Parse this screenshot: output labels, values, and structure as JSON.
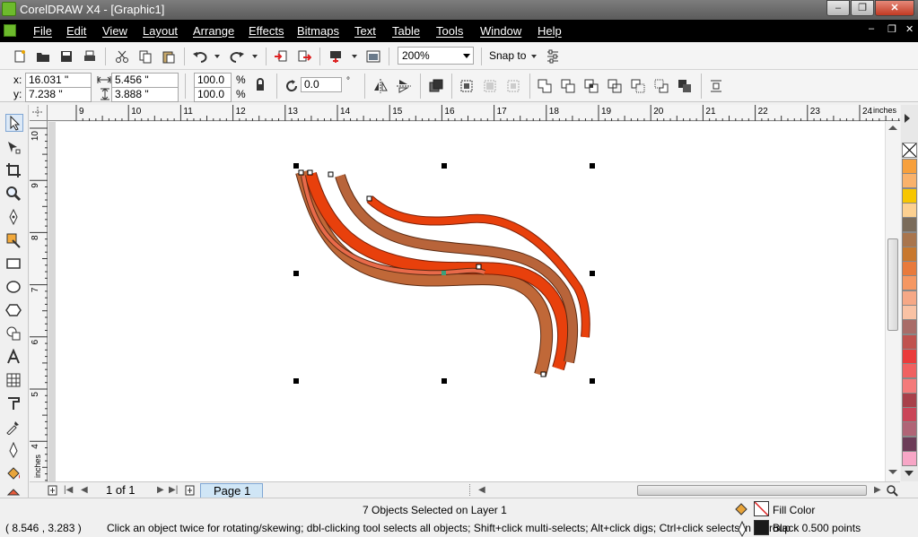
{
  "window": {
    "title": "CorelDRAW X4 - [Graphic1]",
    "min": "–",
    "max": "❐",
    "close": "✕"
  },
  "menu": [
    "File",
    "Edit",
    "View",
    "Layout",
    "Arrange",
    "Effects",
    "Bitmaps",
    "Text",
    "Table",
    "Tools",
    "Window",
    "Help"
  ],
  "doc_controls": {
    "min": "–",
    "restore": "❐",
    "close": "✕"
  },
  "toolbar": {
    "zoom": "200%",
    "snap_to": "Snap to"
  },
  "propbar": {
    "x_label": "x:",
    "x": "16.031 \"",
    "y_label": "y:",
    "y": "7.238 \"",
    "width": "5.456 \"",
    "height": "3.888 \"",
    "scale_x": "100.0",
    "scale_y": "100.0",
    "pct1": "%",
    "pct2": "%",
    "angle": "0.0",
    "deg": "°"
  },
  "ruler_h": {
    "unit": "inches",
    "ticks": [
      "9",
      "10",
      "11",
      "12",
      "13",
      "14",
      "15",
      "16",
      "17",
      "18",
      "19",
      "20",
      "21",
      "22",
      "23",
      "24"
    ]
  },
  "ruler_v": {
    "unit": "inches",
    "ticks": [
      "10",
      "9",
      "8",
      "7",
      "6",
      "5",
      "4"
    ]
  },
  "page_nav": {
    "counter": "1 of 1",
    "page_tab": "Page 1"
  },
  "status": {
    "message": "7 Objects Selected on Layer 1",
    "coords": "( 8.546 , 3.283 )",
    "hint": "Click an object twice for rotating/skewing; dbl-clicking tool selects all objects; Shift+click multi-selects; Alt+click digs; Ctrl+click selects in a group",
    "fill": "Fill Color",
    "outline": "Black  0.500 points"
  },
  "colors": {
    "palette": [
      "#f7a03c",
      "#f9b26b",
      "#f7c600",
      "#fcd090",
      "#7a6b5a",
      "#a9754d",
      "#c8782e",
      "#e87a3c",
      "#f59762",
      "#f6a886",
      "#f9c2a4",
      "#a96c68",
      "#c0524e",
      "#ea3b3b",
      "#f06060",
      "#f47a7a",
      "#a8404a",
      "#ca4558",
      "#b06476",
      "#6c3c58",
      "#f7a6c6"
    ],
    "stroke_a": "#e8401a",
    "stroke_b": "#c0602e"
  }
}
